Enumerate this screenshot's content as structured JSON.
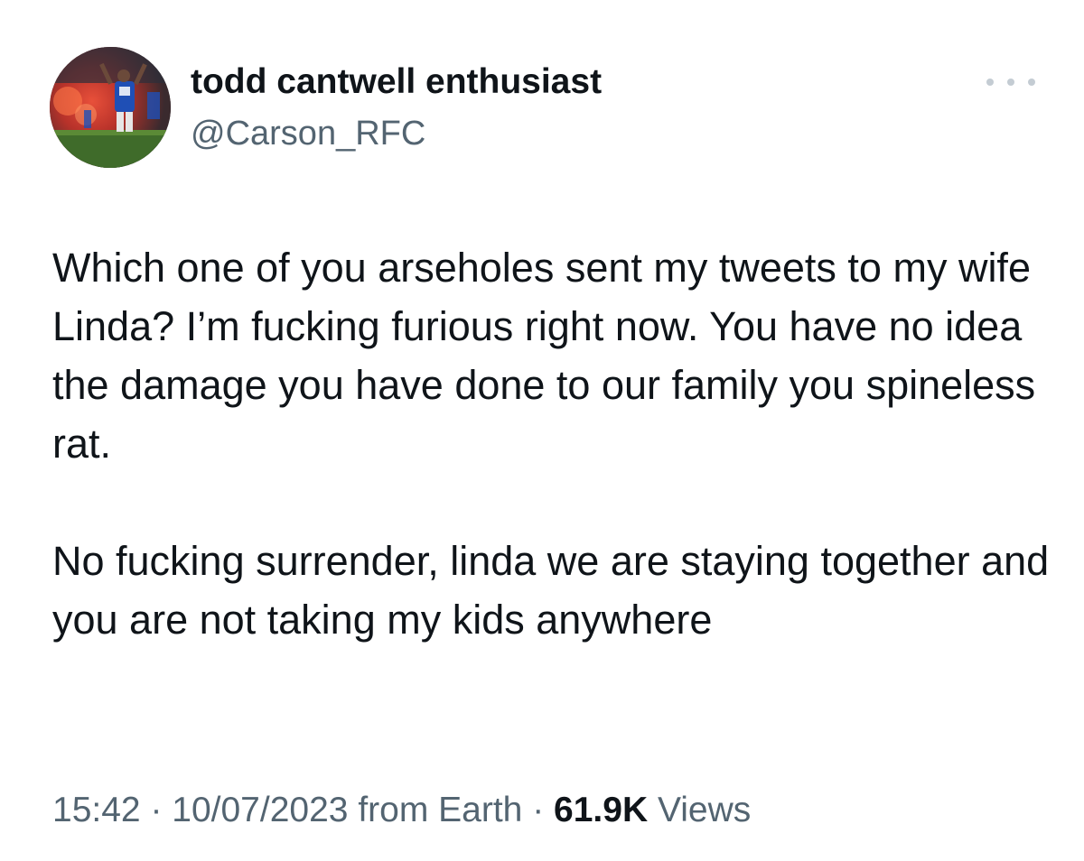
{
  "author": {
    "display_name": "todd cantwell enthusiast",
    "handle": "@Carson_RFC",
    "avatar_icon": "profile-photo"
  },
  "tweet": {
    "paragraphs": [
      "Which one of you arseholes sent my tweets to my wife Linda? I’m fucking furious right now. You have no idea the damage you have done to our family you spineless rat.",
      "No fucking surrender, linda we are staying together and you are not taking my kids anywhere"
    ]
  },
  "meta": {
    "time": "15:42",
    "separator": " · ",
    "date": "10/07/2023",
    "source": " from Earth",
    "views_count": "61.9K",
    "views_label": " Views"
  },
  "more_icon": "more-horizontal-icon",
  "colors": {
    "text_primary": "#0f1419",
    "text_secondary": "#536471",
    "background": "#ffffff"
  }
}
